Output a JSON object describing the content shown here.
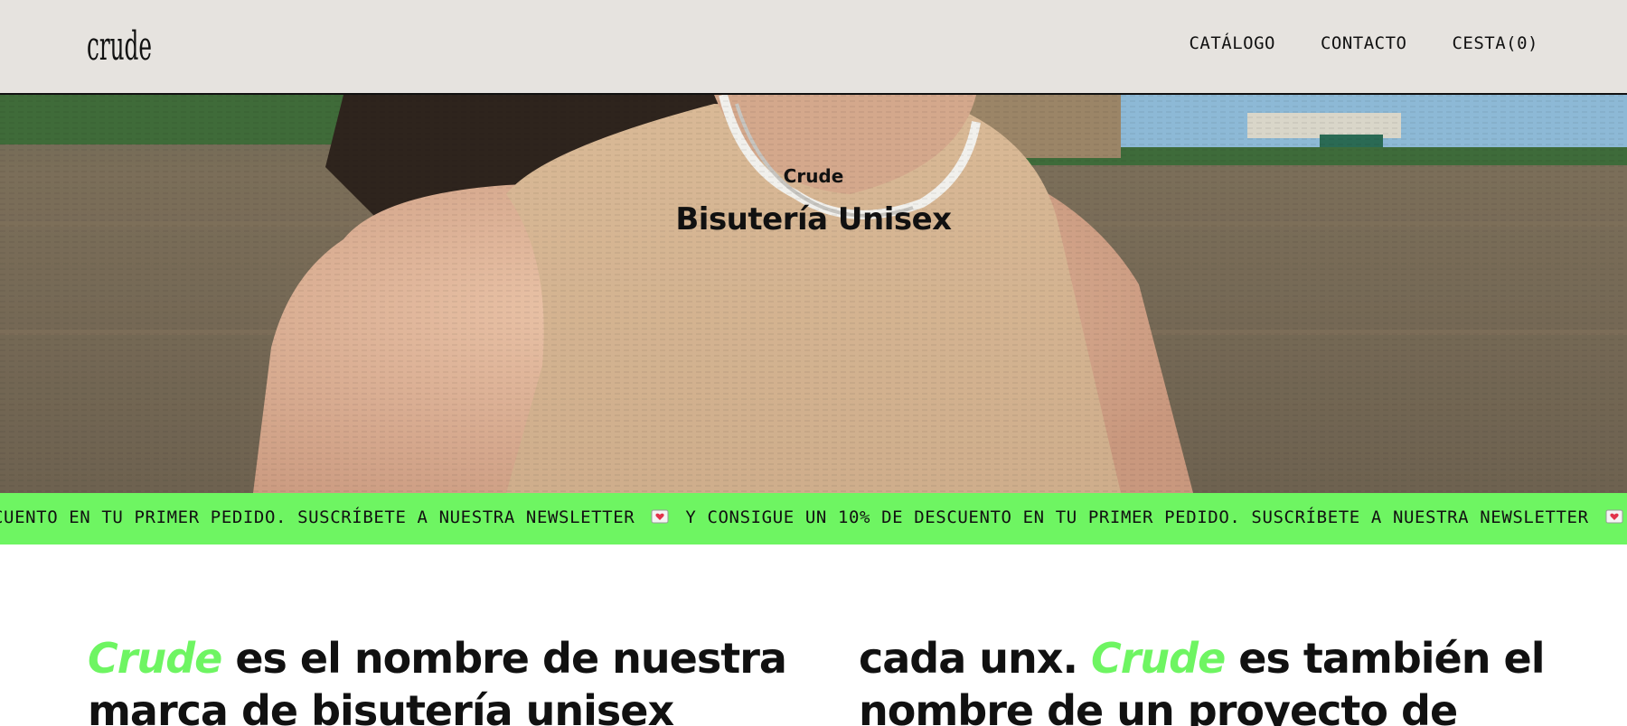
{
  "header": {
    "logo_text": "crude",
    "nav": [
      {
        "label": "CATÁLOGO"
      },
      {
        "label": "CONTACTO"
      },
      {
        "label": "CESTA(0)"
      }
    ]
  },
  "hero": {
    "subtitle": "Crude",
    "title": "Bisutería Unisex"
  },
  "marquee": {
    "segments": [
      "CUENTO EN TU PRIMER PEDIDO. SUSCRÍBETE A NUESTRA NEWSLETTER",
      "Y CONSIGUE UN 10% DE DESCUENTO EN TU PRIMER PEDIDO. SUSCRÍBETE A NUESTRA NEWSLETTER",
      "Y"
    ],
    "icon": "heart-envelope-icon",
    "background": "#6ef562"
  },
  "intro": {
    "left": {
      "line1_accent": "Crude",
      "line1_rest": " es el nombre de nuestra",
      "line2": "marca de bisutería unisex"
    },
    "right": {
      "line1_start": "cada unx. ",
      "line1_accent": "Crude",
      "line1_rest": " es también el",
      "line2": "nombre de un proyecto de"
    }
  },
  "colors": {
    "header_bg": "#e6e3df",
    "accent_green": "#6ef562",
    "text": "#111111"
  }
}
